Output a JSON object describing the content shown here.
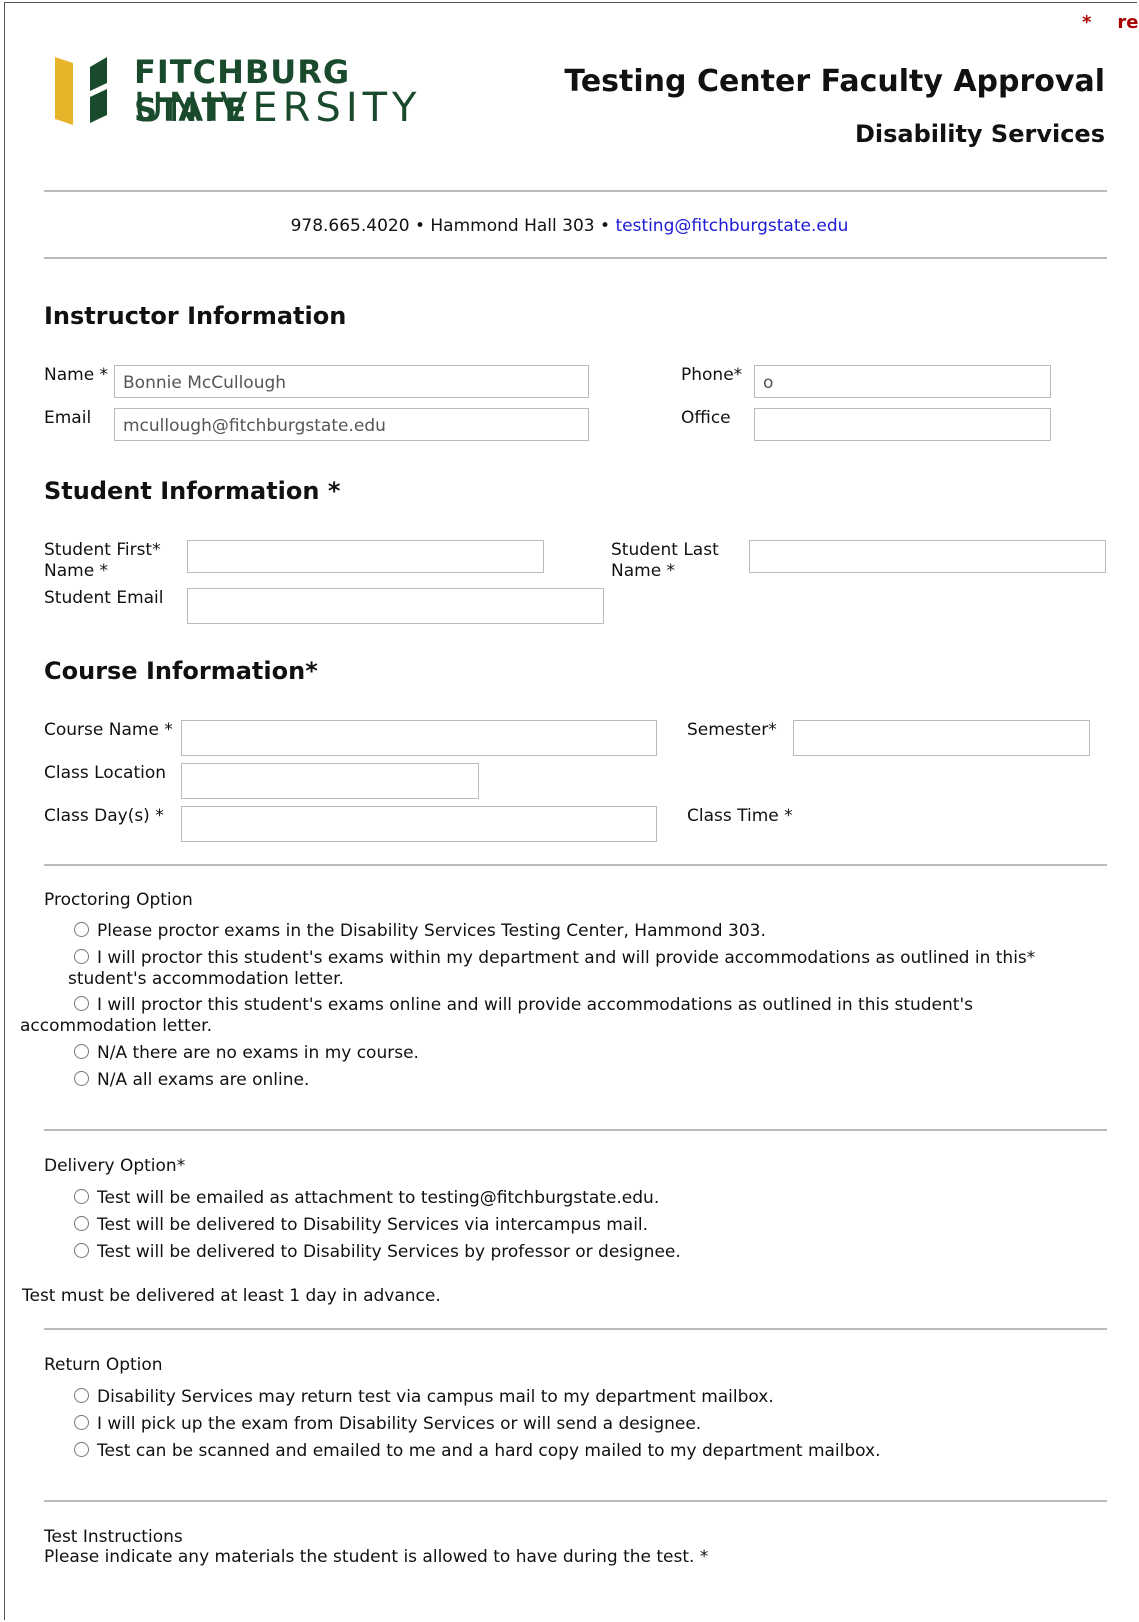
{
  "corner": {
    "asterisk": "*",
    "re": "re"
  },
  "logo": {
    "line1": "FITCHBURG STATE",
    "line2": "UNIVERSITY",
    "brand_green": "#1a4a2c",
    "brand_gold": "#e8b52a"
  },
  "header": {
    "title": "Testing Center Faculty Approval",
    "subtitle": "Disability Services"
  },
  "contact": {
    "phone": "978.665.4020",
    "sep1": " • ",
    "address": "Hammond Hall 303",
    "sep2": " • ",
    "email": "testing@fitchburgstate.edu"
  },
  "instructor": {
    "heading": "Instructor Information",
    "name_label": "Name *",
    "name_value": "Bonnie McCullough",
    "email_label": "Email",
    "email_value": "mcullough@fitchburgstate.edu",
    "phone_label": "Phone*",
    "phone_value": "o",
    "office_label": "Office",
    "office_value": ""
  },
  "student": {
    "heading": "Student Information *",
    "first_label": "Student First* Name *",
    "last_label": "Student Last Name *",
    "email_label": "Student Email"
  },
  "course": {
    "heading": "Course Information*",
    "name_label": "Course Name *",
    "semester_label": "Semester*",
    "location_label": "Class Location",
    "days_label": "Class Day(s) *",
    "time_label": "Class Time *"
  },
  "proctoring": {
    "title": "Proctoring Option",
    "options": [
      "Please proctor exams in the Disability Services Testing Center, Hammond 303.",
      "I will proctor this student's exams within my department and will provide accommodations as outlined in this*",
      "I will proctor this student's exams online and will provide accommodations as outlined in this student's",
      "N/A there are no exams in my course.",
      "N/A all exams are online."
    ],
    "option2_cont": "student's accommodation letter.",
    "option3_cont": "accommodation letter."
  },
  "delivery": {
    "title": "Delivery Option*",
    "options": [
      "Test will be emailed as attachment to testing@fitchburgstate.edu.",
      "Test will be delivered to Disability Services via intercampus mail.",
      "Test will be delivered to Disability Services by professor or designee."
    ],
    "note": "Test must be delivered at least 1 day in advance."
  },
  "return": {
    "title": "Return Option",
    "options": [
      "Disability Services may return test via campus mail to my department mailbox.",
      "I will pick up the exam from Disability Services or will send a designee.",
      "Test can be scanned and emailed to me and a hard copy mailed to my department mailbox."
    ]
  },
  "instructions": {
    "title": "Test Instructions",
    "help": "Please indicate any materials the student is allowed to have during the test. *"
  }
}
